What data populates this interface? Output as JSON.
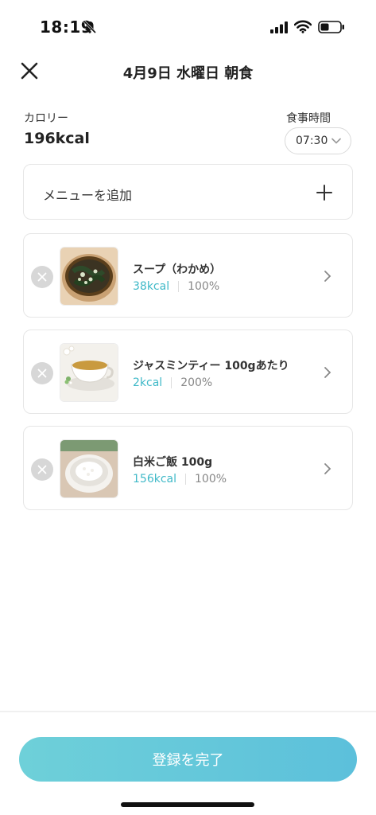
{
  "status_bar": {
    "time": "18:19",
    "icons": [
      "bell-slash-icon",
      "cellular-signal-icon",
      "wifi-icon",
      "battery-icon"
    ]
  },
  "header": {
    "title": "4月9日 水曜日 朝食",
    "close_icon": "close-icon"
  },
  "summary": {
    "calorie_label": "カロリー",
    "calorie_value": "196kcal",
    "mealtime_label": "食事時間",
    "mealtime_value": "07:30"
  },
  "add_menu": {
    "label": "メニューを追加",
    "icon": "plus-icon"
  },
  "items": [
    {
      "name": "スープ（わかめ）",
      "kcal": "38kcal",
      "percent": "100%",
      "image": "wakame-soup"
    },
    {
      "name": "ジャスミンティー 100gあたり",
      "kcal": "2kcal",
      "percent": "200%",
      "image": "jasmine-tea"
    },
    {
      "name": "白米ご飯 100g",
      "kcal": "156kcal",
      "percent": "100%",
      "image": "white-rice"
    }
  ],
  "submit_label": "登録を完了",
  "colors": {
    "accent": "#3fb9c8",
    "button_gradient_start": "#6ed0d9",
    "button_gradient_end": "#5cc0db",
    "card_border": "#e6e6e6"
  }
}
